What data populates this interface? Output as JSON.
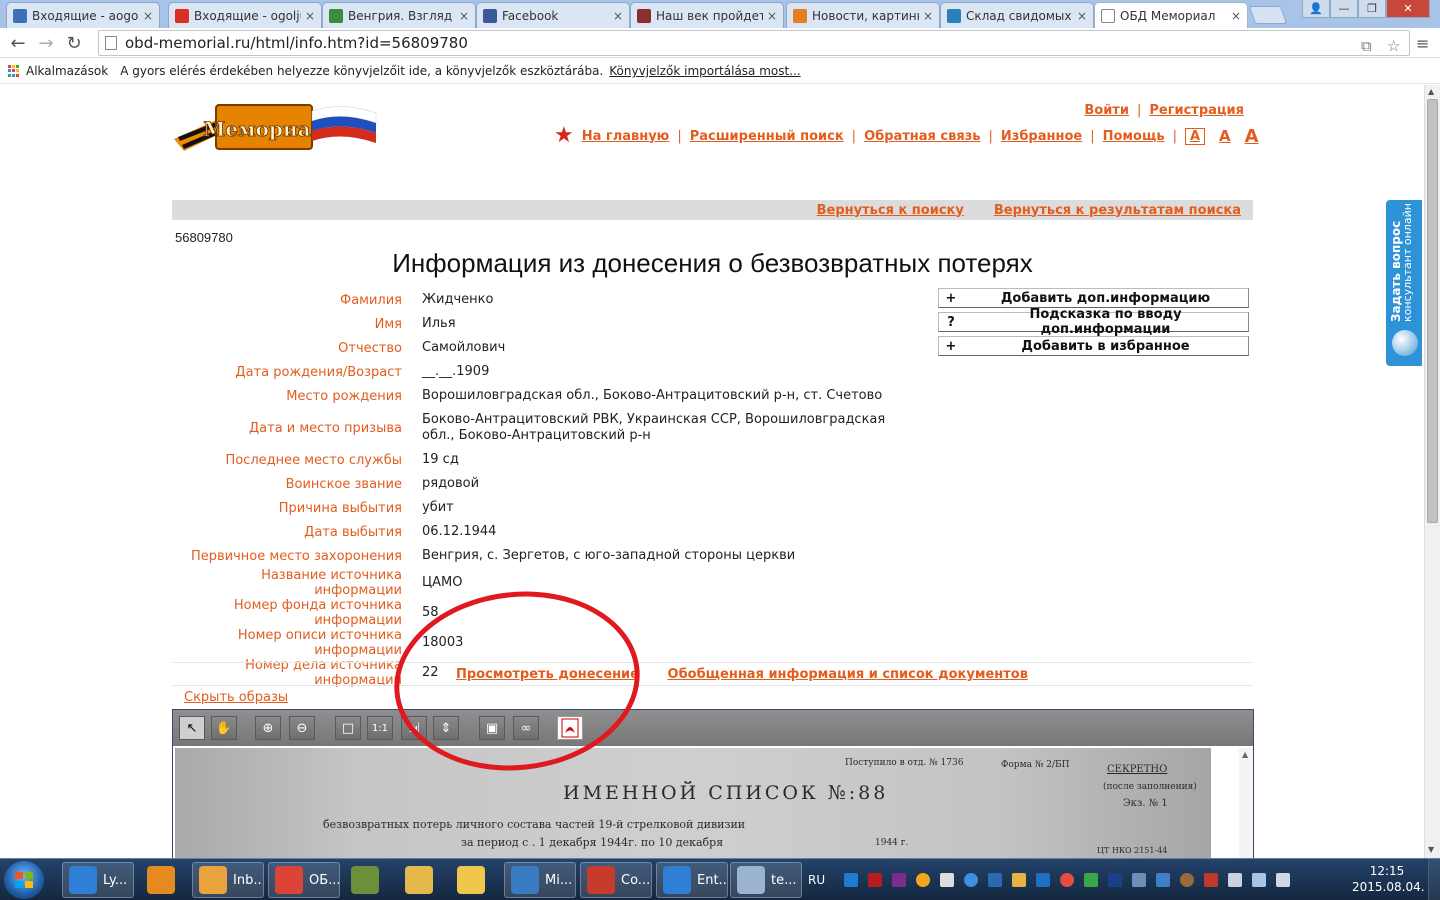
{
  "browser": {
    "tabs": [
      {
        "label": "Входящие - aogolj",
        "favicon": "mail-globe-icon",
        "color": "#3b6fb6"
      },
      {
        "label": "Входящие - ogolju",
        "favicon": "gmail-icon",
        "color": "#d93025"
      },
      {
        "label": "Венгрия. Взгляд из",
        "favicon": "hungary-flag-icon",
        "color": "#3a8d3a"
      },
      {
        "label": "Facebook",
        "favicon": "facebook-icon",
        "color": "#3b5998"
      },
      {
        "label": "Наш век пройдет",
        "favicon": "portrait-icon",
        "color": "#8a2e2e"
      },
      {
        "label": "Новости, картинк",
        "favicon": "news-icon",
        "color": "#e67e22"
      },
      {
        "label": "Склад свидомых п",
        "favicon": "bird-icon",
        "color": "#2c7fb8"
      },
      {
        "label": "ОБД Мемориал",
        "favicon": "page-icon",
        "color": "#ffffff"
      }
    ],
    "active_tab": 7,
    "close_glyph": "×",
    "url": "obd-memorial.ru/html/info.htm?id=56809780",
    "bookmarks": {
      "apps_label": "Alkalmazások",
      "hint": "A gyors elérés érdekében helyezze könyvjelzőit ide, a könyvjelzők eszköztárába.",
      "import_link": "Könyvjelzők importálása most..."
    }
  },
  "site": {
    "logo_text": "Мемориал",
    "top_links": {
      "login": "Войти",
      "register": "Регистрация"
    },
    "nav": [
      {
        "label": "На главную"
      },
      {
        "label": "Расширенный поиск"
      },
      {
        "label": "Обратная связь"
      },
      {
        "label": "Избранное"
      },
      {
        "label": "Помощь"
      }
    ],
    "font_sizes": [
      "А",
      "А",
      "А"
    ],
    "back_links": {
      "to_search": "Вернуться к поиску",
      "to_results": "Вернуться к результатам поиска"
    }
  },
  "record": {
    "id": "56809780",
    "title": "Информация из донесения о безвозвратных потерях",
    "fields": [
      {
        "label": "Фамилия",
        "value": "Жидченко"
      },
      {
        "label": "Имя",
        "value": "Илья"
      },
      {
        "label": "Отчество",
        "value": "Самойлович"
      },
      {
        "label": "Дата рождения/Возраст",
        "value": "__.__.1909"
      },
      {
        "label": "Место рождения",
        "value": "Ворошиловградская обл., Боково-Антрацитовский р-н, ст. Счетово"
      },
      {
        "label": "Дата и место призыва",
        "value": "Боково-Антрацитовский РВК, Украинская ССР, Ворошиловградская обл., Боково-Антрацитовский р-н"
      },
      {
        "label": "Последнее место службы",
        "value": "19 сд"
      },
      {
        "label": "Воинское звание",
        "value": "рядовой"
      },
      {
        "label": "Причина выбытия",
        "value": "убит"
      },
      {
        "label": "Дата выбытия",
        "value": "06.12.1944"
      },
      {
        "label": "Первичное место захоронения",
        "value": "Венгрия, с. Зергетов, с юго-западной стороны церкви"
      },
      {
        "label": "Название источника информации",
        "value": "ЦАМО"
      },
      {
        "label": "Номер фонда источника информации",
        "value": "58"
      },
      {
        "label": "Номер описи источника информации",
        "value": "18003"
      },
      {
        "label": "Номер дела источника информации",
        "value": "22"
      }
    ],
    "actions": [
      {
        "symbol": "+",
        "label": "Добавить доп.информацию"
      },
      {
        "symbol": "?",
        "label": "Подсказка по вводу доп.информации"
      },
      {
        "symbol": "+",
        "label": "Добавить в избранное"
      }
    ],
    "view_report": "Просмотреть донесение",
    "summary_link": "Обобщенная информация и список документов",
    "hide_images": "Скрыть образы"
  },
  "viewer": {
    "doc_heading": "ИМЕННОЙ СПИСОК №:88",
    "doc_line1": "безвозвратных потерь личного состава    частей 19-й  стрелковой  дивизии",
    "doc_line2": "за период с . 1      декабря  1944г. по  10  декабря",
    "doc_corner": "СЕКРЕТНО",
    "doc_corner2": "(после заполнения)",
    "doc_copy": "Экз. № 1",
    "doc_stamp": "Поступило в отд. № 1736",
    "doc_form": "Форма № 2/БП",
    "doc_year": "1944 г.",
    "doc_nko": "ЦТ НКО 2151-44"
  },
  "consult_widget": {
    "line1": "Задать вопрос",
    "line2": "консультант онлайн"
  },
  "taskbar": {
    "buttons": [
      {
        "label": "Ly...",
        "icon": "ie-icon",
        "color": "#2f7fd6"
      },
      {
        "label": "",
        "icon": "media-player-icon",
        "color": "#e58a1f"
      },
      {
        "label": "Inb...",
        "icon": "outlook-icon",
        "color": "#e8a33c"
      },
      {
        "label": "ОБ...",
        "icon": "chrome-icon",
        "color": "#db4437"
      },
      {
        "label": "",
        "icon": "network-icon",
        "color": "#6c8f3a"
      },
      {
        "label": "",
        "icon": "explorer-folder-icon",
        "color": "#e4b84a"
      },
      {
        "label": "",
        "icon": "folders-icon",
        "color": "#f0c64d"
      },
      {
        "label": "Mi...",
        "icon": "lync-icon",
        "color": "#3a7cc2"
      },
      {
        "label": "Co...",
        "icon": "toolbox-icon",
        "color": "#c83a2a"
      },
      {
        "label": "Ent...",
        "icon": "ie-icon",
        "color": "#2f7fd6"
      },
      {
        "label": "te...",
        "icon": "notepad-icon",
        "color": "#9ab3cf"
      }
    ],
    "lang": "RU",
    "time": "12:15",
    "date": "2015.08.04."
  }
}
